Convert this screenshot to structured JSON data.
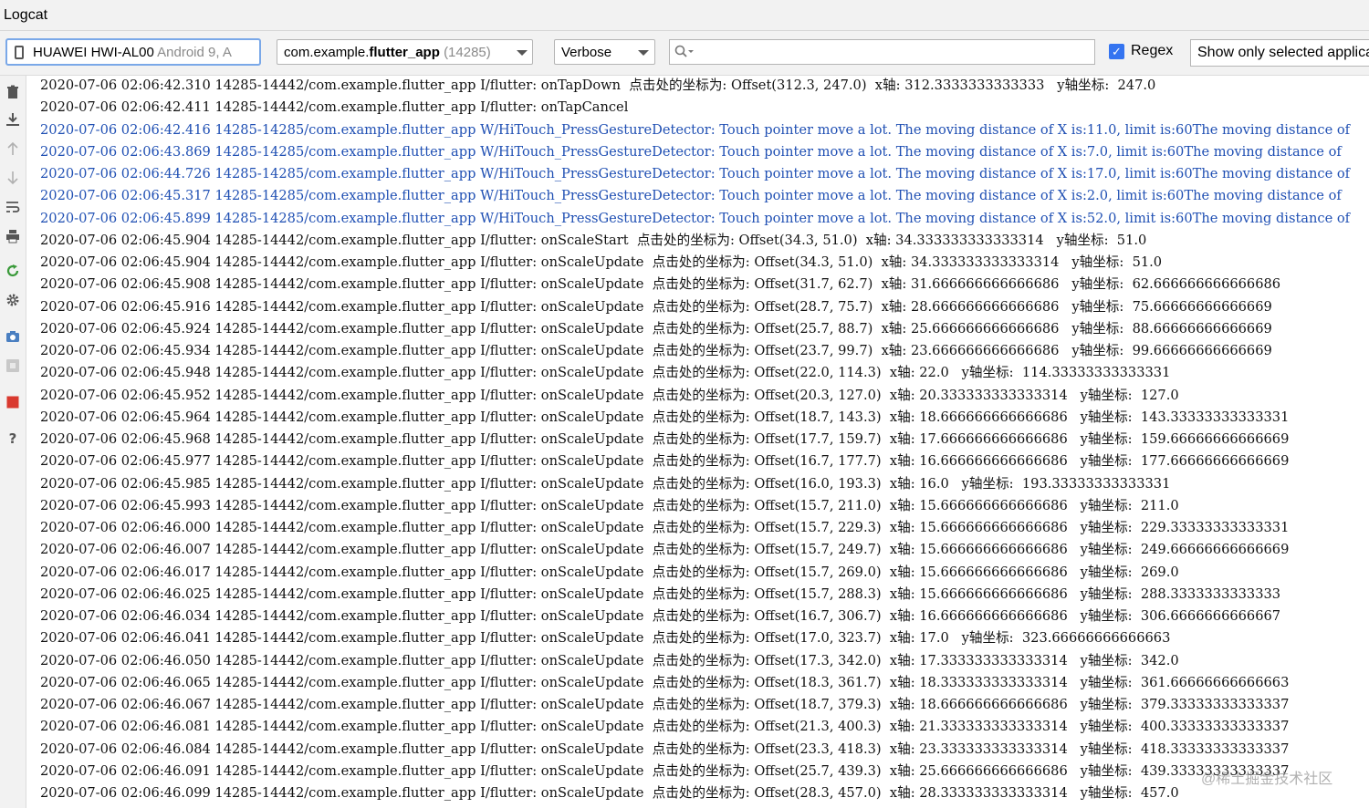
{
  "window": {
    "title": "Logcat"
  },
  "toolbar": {
    "device_name": "HUAWEI HWI-AL00",
    "device_os": "Android 9, A",
    "process_name_prefix": "com.example.",
    "process_name_bold": "flutter_app",
    "process_pid": "(14285)",
    "log_level": "Verbose",
    "search_value": "",
    "regex_label": "Regex",
    "regex_checked": "✓",
    "filter": "Show only selected applica"
  },
  "side_toolbar": {
    "icons": [
      "trash-icon",
      "scroll-to-end-icon",
      "up-arrow-icon",
      "down-arrow-icon",
      "soft-wrap-icon",
      "print-icon",
      "restart-icon",
      "settings-icon",
      "screenshot-icon",
      "screen-record-icon",
      "stop-icon",
      "help-icon"
    ],
    "colors": {
      "restart": "#3a9a3a",
      "stop": "#d9392f",
      "warn_text": "#1f4fb3"
    }
  },
  "log_lines": [
    {
      "text": "2020-07-06 02:06:42.310 14285-14442/com.example.flutter_app I/flutter: onTapDown  点击处的坐标为: Offset(312.3, 247.0)  x轴: 312.3333333333333   y轴坐标:  247.0",
      "level": "I"
    },
    {
      "text": "2020-07-06 02:06:42.411 14285-14442/com.example.flutter_app I/flutter: onTapCancel",
      "level": "I"
    },
    {
      "text": "2020-07-06 02:06:42.416 14285-14285/com.example.flutter_app W/HiTouch_PressGestureDetector: Touch pointer move a lot. The moving distance of X is:11.0, limit is:60The moving distance of",
      "level": "W"
    },
    {
      "text": "2020-07-06 02:06:43.869 14285-14285/com.example.flutter_app W/HiTouch_PressGestureDetector: Touch pointer move a lot. The moving distance of X is:7.0, limit is:60The moving distance of",
      "level": "W"
    },
    {
      "text": "2020-07-06 02:06:44.726 14285-14285/com.example.flutter_app W/HiTouch_PressGestureDetector: Touch pointer move a lot. The moving distance of X is:17.0, limit is:60The moving distance of",
      "level": "W"
    },
    {
      "text": "2020-07-06 02:06:45.317 14285-14285/com.example.flutter_app W/HiTouch_PressGestureDetector: Touch pointer move a lot. The moving distance of X is:2.0, limit is:60The moving distance of",
      "level": "W"
    },
    {
      "text": "2020-07-06 02:06:45.899 14285-14285/com.example.flutter_app W/HiTouch_PressGestureDetector: Touch pointer move a lot. The moving distance of X is:52.0, limit is:60The moving distance of",
      "level": "W"
    },
    {
      "text": "2020-07-06 02:06:45.904 14285-14442/com.example.flutter_app I/flutter: onScaleStart  点击处的坐标为: Offset(34.3, 51.0)  x轴: 34.333333333333314   y轴坐标:  51.0",
      "level": "I"
    },
    {
      "text": "2020-07-06 02:06:45.904 14285-14442/com.example.flutter_app I/flutter: onScaleUpdate  点击处的坐标为: Offset(34.3, 51.0)  x轴: 34.333333333333314   y轴坐标:  51.0",
      "level": "I"
    },
    {
      "text": "2020-07-06 02:06:45.908 14285-14442/com.example.flutter_app I/flutter: onScaleUpdate  点击处的坐标为: Offset(31.7, 62.7)  x轴: 31.666666666666686   y轴坐标:  62.666666666666686",
      "level": "I"
    },
    {
      "text": "2020-07-06 02:06:45.916 14285-14442/com.example.flutter_app I/flutter: onScaleUpdate  点击处的坐标为: Offset(28.7, 75.7)  x轴: 28.666666666666686   y轴坐标:  75.66666666666669",
      "level": "I"
    },
    {
      "text": "2020-07-06 02:06:45.924 14285-14442/com.example.flutter_app I/flutter: onScaleUpdate  点击处的坐标为: Offset(25.7, 88.7)  x轴: 25.666666666666686   y轴坐标:  88.66666666666669",
      "level": "I"
    },
    {
      "text": "2020-07-06 02:06:45.934 14285-14442/com.example.flutter_app I/flutter: onScaleUpdate  点击处的坐标为: Offset(23.7, 99.7)  x轴: 23.666666666666686   y轴坐标:  99.66666666666669",
      "level": "I"
    },
    {
      "text": "2020-07-06 02:06:45.948 14285-14442/com.example.flutter_app I/flutter: onScaleUpdate  点击处的坐标为: Offset(22.0, 114.3)  x轴: 22.0   y轴坐标:  114.33333333333331",
      "level": "I"
    },
    {
      "text": "2020-07-06 02:06:45.952 14285-14442/com.example.flutter_app I/flutter: onScaleUpdate  点击处的坐标为: Offset(20.3, 127.0)  x轴: 20.333333333333314   y轴坐标:  127.0",
      "level": "I"
    },
    {
      "text": "2020-07-06 02:06:45.964 14285-14442/com.example.flutter_app I/flutter: onScaleUpdate  点击处的坐标为: Offset(18.7, 143.3)  x轴: 18.666666666666686   y轴坐标:  143.33333333333331",
      "level": "I"
    },
    {
      "text": "2020-07-06 02:06:45.968 14285-14442/com.example.flutter_app I/flutter: onScaleUpdate  点击处的坐标为: Offset(17.7, 159.7)  x轴: 17.666666666666686   y轴坐标:  159.66666666666669",
      "level": "I"
    },
    {
      "text": "2020-07-06 02:06:45.977 14285-14442/com.example.flutter_app I/flutter: onScaleUpdate  点击处的坐标为: Offset(16.7, 177.7)  x轴: 16.666666666666686   y轴坐标:  177.66666666666669",
      "level": "I"
    },
    {
      "text": "2020-07-06 02:06:45.985 14285-14442/com.example.flutter_app I/flutter: onScaleUpdate  点击处的坐标为: Offset(16.0, 193.3)  x轴: 16.0   y轴坐标:  193.33333333333331",
      "level": "I"
    },
    {
      "text": "2020-07-06 02:06:45.993 14285-14442/com.example.flutter_app I/flutter: onScaleUpdate  点击处的坐标为: Offset(15.7, 211.0)  x轴: 15.666666666666686   y轴坐标:  211.0",
      "level": "I"
    },
    {
      "text": "2020-07-06 02:06:46.000 14285-14442/com.example.flutter_app I/flutter: onScaleUpdate  点击处的坐标为: Offset(15.7, 229.3)  x轴: 15.666666666666686   y轴坐标:  229.33333333333331",
      "level": "I"
    },
    {
      "text": "2020-07-06 02:06:46.007 14285-14442/com.example.flutter_app I/flutter: onScaleUpdate  点击处的坐标为: Offset(15.7, 249.7)  x轴: 15.666666666666686   y轴坐标:  249.66666666666669",
      "level": "I"
    },
    {
      "text": "2020-07-06 02:06:46.017 14285-14442/com.example.flutter_app I/flutter: onScaleUpdate  点击处的坐标为: Offset(15.7, 269.0)  x轴: 15.666666666666686   y轴坐标:  269.0",
      "level": "I"
    },
    {
      "text": "2020-07-06 02:06:46.025 14285-14442/com.example.flutter_app I/flutter: onScaleUpdate  点击处的坐标为: Offset(15.7, 288.3)  x轴: 15.666666666666686   y轴坐标:  288.3333333333333",
      "level": "I"
    },
    {
      "text": "2020-07-06 02:06:46.034 14285-14442/com.example.flutter_app I/flutter: onScaleUpdate  点击处的坐标为: Offset(16.7, 306.7)  x轴: 16.666666666666686   y轴坐标:  306.6666666666667",
      "level": "I"
    },
    {
      "text": "2020-07-06 02:06:46.041 14285-14442/com.example.flutter_app I/flutter: onScaleUpdate  点击处的坐标为: Offset(17.0, 323.7)  x轴: 17.0   y轴坐标:  323.66666666666663",
      "level": "I"
    },
    {
      "text": "2020-07-06 02:06:46.050 14285-14442/com.example.flutter_app I/flutter: onScaleUpdate  点击处的坐标为: Offset(17.3, 342.0)  x轴: 17.333333333333314   y轴坐标:  342.0",
      "level": "I"
    },
    {
      "text": "2020-07-06 02:06:46.065 14285-14442/com.example.flutter_app I/flutter: onScaleUpdate  点击处的坐标为: Offset(18.3, 361.7)  x轴: 18.333333333333314   y轴坐标:  361.66666666666663",
      "level": "I"
    },
    {
      "text": "2020-07-06 02:06:46.067 14285-14442/com.example.flutter_app I/flutter: onScaleUpdate  点击处的坐标为: Offset(18.7, 379.3)  x轴: 18.666666666666686   y轴坐标:  379.33333333333337",
      "level": "I"
    },
    {
      "text": "2020-07-06 02:06:46.081 14285-14442/com.example.flutter_app I/flutter: onScaleUpdate  点击处的坐标为: Offset(21.3, 400.3)  x轴: 21.333333333333314   y轴坐标:  400.33333333333337",
      "level": "I"
    },
    {
      "text": "2020-07-06 02:06:46.084 14285-14442/com.example.flutter_app I/flutter: onScaleUpdate  点击处的坐标为: Offset(23.3, 418.3)  x轴: 23.333333333333314   y轴坐标:  418.33333333333337",
      "level": "I"
    },
    {
      "text": "2020-07-06 02:06:46.091 14285-14442/com.example.flutter_app I/flutter: onScaleUpdate  点击处的坐标为: Offset(25.7, 439.3)  x轴: 25.666666666666686   y轴坐标:  439.33333333333337",
      "level": "I"
    },
    {
      "text": "2020-07-06 02:06:46.099 14285-14442/com.example.flutter_app I/flutter: onScaleUpdate  点击处的坐标为: Offset(28.3, 457.0)  x轴: 28.333333333333314   y轴坐标:  457.0",
      "level": "I"
    }
  ],
  "watermark": "@稀土掘金技术社区"
}
